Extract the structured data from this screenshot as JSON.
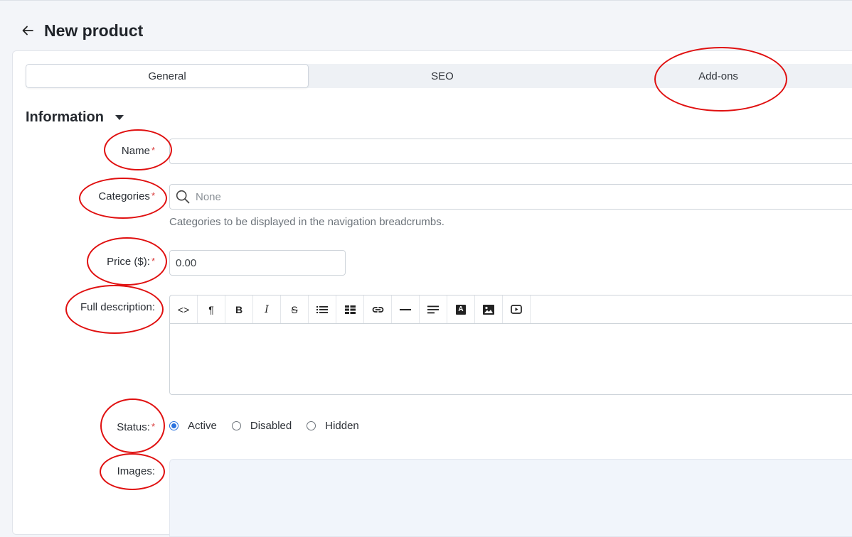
{
  "header": {
    "title": "New product",
    "back_icon": "arrow-left-icon"
  },
  "tabs": [
    {
      "label": "General",
      "active": true
    },
    {
      "label": "SEO",
      "active": false
    },
    {
      "label": "Add-ons",
      "active": false
    }
  ],
  "section": {
    "title": "Information",
    "toggle_icon": "caret-down-icon"
  },
  "form": {
    "name": {
      "label": "Name",
      "required_mark": "*",
      "value": ""
    },
    "categories": {
      "label": "Categories",
      "required_mark": "*",
      "placeholder": "None",
      "help": "Categories to be displayed in the navigation breadcrumbs.",
      "icon": "search-icon"
    },
    "price": {
      "label": "Price ($):",
      "required_mark": "*",
      "value": "0.00"
    },
    "description": {
      "label": "Full description:",
      "toolbar": [
        {
          "name": "code-view-icon",
          "glyph": "<>"
        },
        {
          "name": "paragraph-icon",
          "glyph": "¶"
        },
        {
          "name": "bold-icon",
          "glyph": "B"
        },
        {
          "name": "italic-icon",
          "glyph": "I"
        },
        {
          "name": "strikethrough-icon",
          "glyph": "S"
        },
        {
          "name": "bullet-list-icon"
        },
        {
          "name": "table-icon"
        },
        {
          "name": "link-icon"
        },
        {
          "name": "horizontal-rule-icon"
        },
        {
          "name": "align-icon"
        },
        {
          "name": "text-color-icon",
          "glyph": "A"
        },
        {
          "name": "image-icon"
        },
        {
          "name": "video-icon"
        }
      ]
    },
    "status": {
      "label": "Status:",
      "required_mark": "*",
      "options": [
        {
          "label": "Active",
          "checked": true
        },
        {
          "label": "Disabled",
          "checked": false
        },
        {
          "label": "Hidden",
          "checked": false
        }
      ]
    },
    "images": {
      "label": "Images:"
    }
  },
  "colors": {
    "accent": "#2a72de",
    "required": "#d93a3a",
    "annotation": "#e01010"
  }
}
